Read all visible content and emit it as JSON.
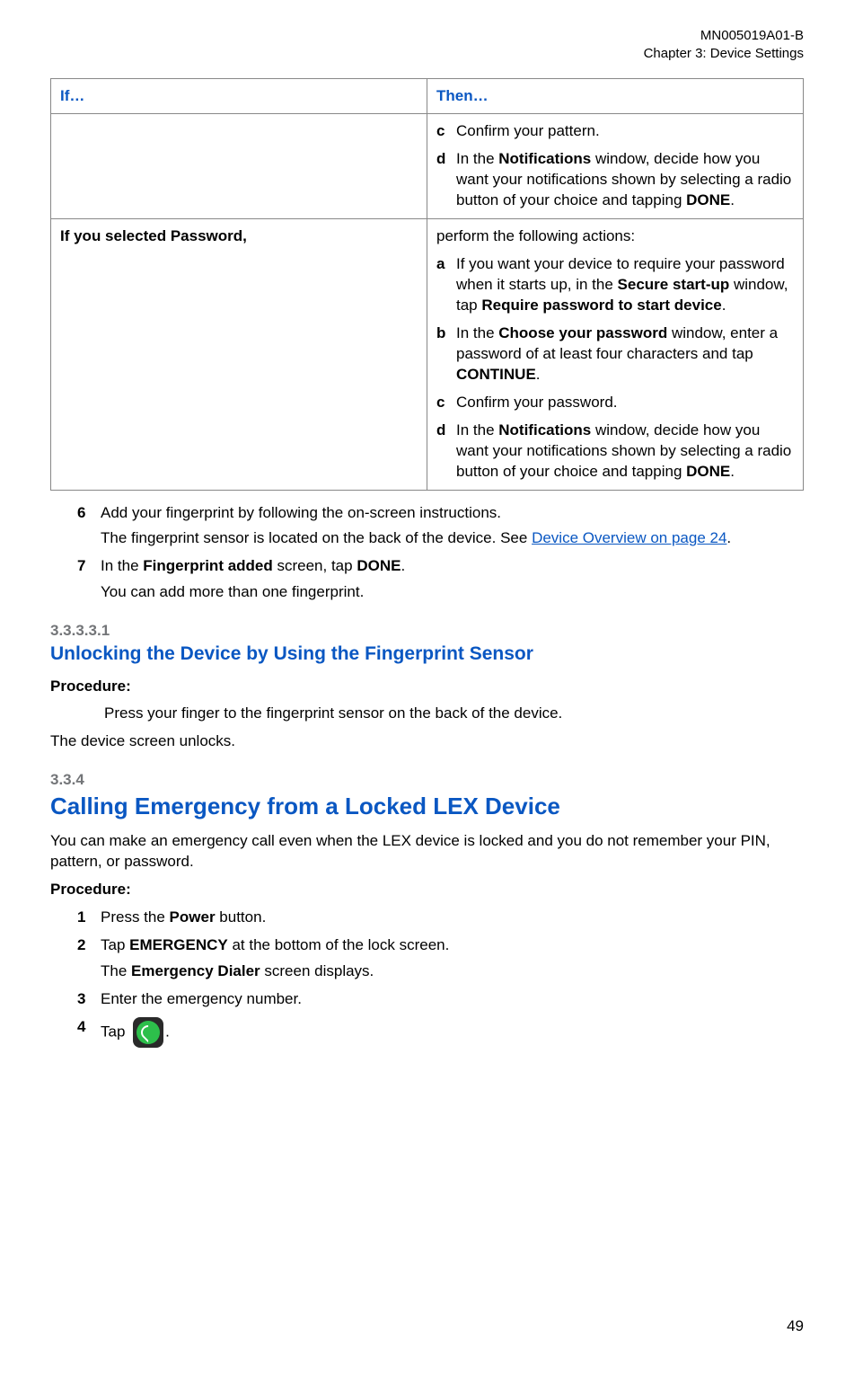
{
  "header": {
    "line1": "MN005019A01-B",
    "line2": "Chapter 3:  Device Settings"
  },
  "table": {
    "if_header": "If…",
    "then_header": "Then…",
    "row1": {
      "if": "",
      "c": "Confirm your pattern.",
      "d_pre": "In the ",
      "d_b1": "Notifications",
      "d_mid": " window, decide how you want your notifications shown by selecting a radio button of your choice and tapping ",
      "d_b2": "DONE",
      "d_post": "."
    },
    "row2": {
      "if": "If you selected Password,",
      "then_intro": "perform the following actions:",
      "a_pre": "If you want your device to require your password when it starts up, in the ",
      "a_b1": "Secure start-up",
      "a_mid": " window, tap ",
      "a_b2": "Require password to start device",
      "a_post": ".",
      "b_pre": "In the ",
      "b_b1": "Choose your password",
      "b_mid": " window, enter a password of at least four characters and tap ",
      "b_b2": "CONTINUE",
      "b_post": ".",
      "c": "Confirm your password.",
      "d_pre": "In the ",
      "d_b1": "Notifications",
      "d_mid": " window, decide how you want your notifications shown by selecting a radio button of your choice and tapping ",
      "d_b2": "DONE",
      "d_post": "."
    }
  },
  "steps_after_table": {
    "s6_line1": "Add your fingerprint by following the on-screen instructions.",
    "s6_line2_pre": "The fingerprint sensor is located on the back of the device. See ",
    "s6_link": "Device Overview on page 24",
    "s6_line2_post": ".",
    "s7_pre": "In the ",
    "s7_b1": "Fingerprint added",
    "s7_mid": " screen, tap ",
    "s7_b2": "DONE",
    "s7_post": ".",
    "s7_line2": "You can add more than one fingerprint."
  },
  "sec33331": {
    "num": "3.3.3.3.1",
    "title": "Unlocking the Device by Using the Fingerprint Sensor",
    "proc_label": "Procedure:",
    "proc_text": "Press your finger to the fingerprint sensor on the back of the device.",
    "result": "The device screen unlocks."
  },
  "sec334": {
    "num": "3.3.4",
    "title": "Calling Emergency from a Locked LEX Device",
    "intro": "You can make an emergency call even when the LEX device is locked and you do not remember your PIN, pattern, or password.",
    "proc_label": "Procedure:",
    "s1_pre": "Press the ",
    "s1_b1": "Power",
    "s1_post": " button.",
    "s2_pre": "Tap ",
    "s2_b1": "EMERGENCY",
    "s2_post": " at the bottom of the lock screen.",
    "s2_line2_pre": "The ",
    "s2_line2_b": "Emergency Dialer",
    "s2_line2_post": " screen displays.",
    "s3": "Enter the emergency number.",
    "s4_pre": "Tap ",
    "s4_post": "."
  },
  "page_num": "49",
  "markers": {
    "a": "a",
    "b": "b",
    "c": "c",
    "d": "d",
    "n1": "1",
    "n2": "2",
    "n3": "3",
    "n4": "4",
    "n6": "6",
    "n7": "7"
  },
  "icons": {
    "phone": "phone-dial-icon"
  }
}
